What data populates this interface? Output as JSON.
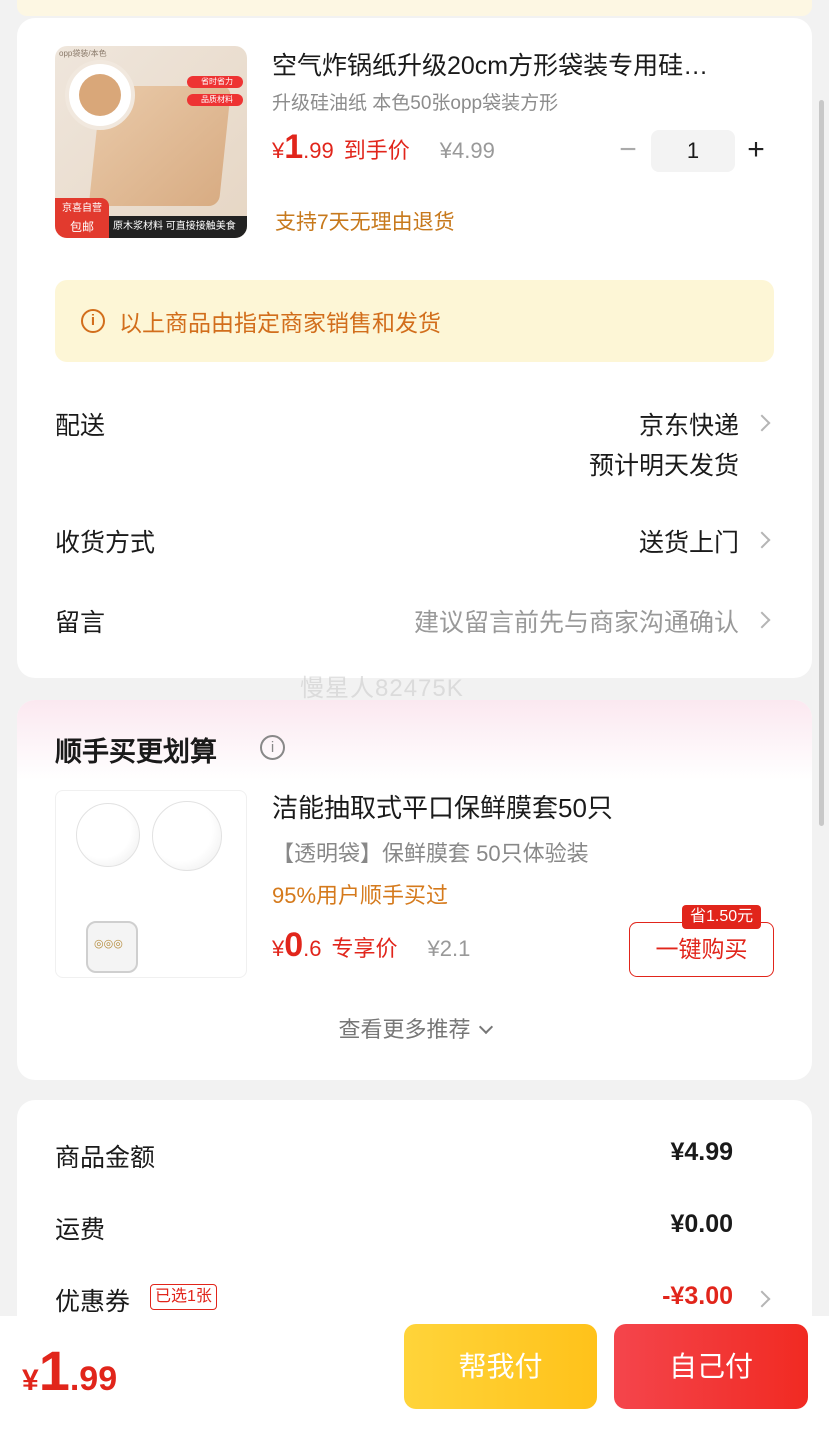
{
  "product": {
    "title": "空气炸锅纸升级20cm方形袋装专用硅…",
    "subtitle": "升级硅油纸 本色50张opp袋装方形",
    "price_currency": "¥",
    "price_int": "1",
    "price_dec": ".99",
    "price_label": "到手价",
    "original_price": "¥4.99",
    "quantity": "1",
    "minus": "−",
    "plus": "+",
    "refund": "支持7天无理由退货",
    "thumb": {
      "top_tag": "opp袋装/本色",
      "pill1": "省时省力",
      "pill2": "品质材料",
      "badge_line1": "京喜自营",
      "badge_line2": "包邮",
      "band": "原木浆材料  可直接接触美食"
    }
  },
  "notice": {
    "text": "以上商品由指定商家销售和发货"
  },
  "rows": {
    "delivery_label": "配送",
    "delivery_value": "京东快递",
    "delivery_note": "预计明天发货",
    "receive_label": "收货方式",
    "receive_value": "送货上门",
    "message_label": "留言",
    "message_placeholder": "建议留言前先与商家沟通确认"
  },
  "watermark": "慢星人82475K",
  "recommend": {
    "title": "顺手买更划算",
    "name": "洁能抽取式平口保鲜膜套50只",
    "sub": "【透明袋】保鲜膜套 50只体验装",
    "pct": "95%用户顺手买过",
    "price_currency": "¥",
    "price_int": "0",
    "price_dec": ".6",
    "price_label": "专享价",
    "original_price": "¥2.1",
    "save_badge": "省1.50元",
    "buy_button": "一键购买",
    "more": "查看更多推荐"
  },
  "summary": {
    "goods_label": "商品金额",
    "goods_value": "¥4.99",
    "shipping_label": "运费",
    "shipping_value": "¥0.00",
    "coupon_label": "优惠券",
    "coupon_tag": "已选1张",
    "coupon_value": "-¥3.00"
  },
  "bottom": {
    "currency": "¥",
    "total_int": "1",
    "total_dec": ".99",
    "help_pay": "帮我付",
    "self_pay": "自己付"
  },
  "colors": {
    "accent": "#e1251b",
    "orange": "#d26e1c",
    "yellow_btn": "#ffc21a"
  }
}
